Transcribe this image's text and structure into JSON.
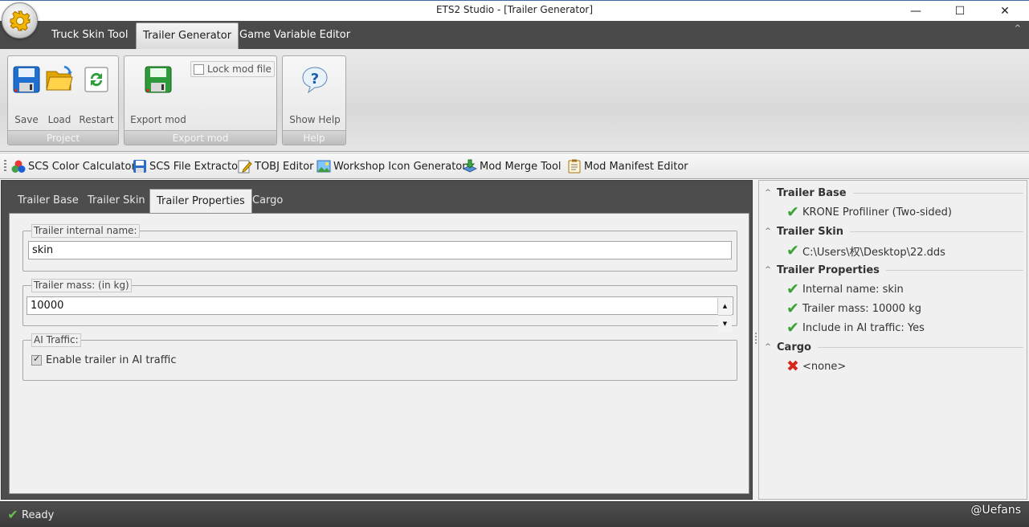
{
  "window": {
    "title": "ETS2 Studio - [Trailer Generator]",
    "minimize_glyph": "—",
    "maximize_glyph": "☐",
    "close_glyph": "✕"
  },
  "ribbon": {
    "tabs": [
      {
        "label": "Truck Skin Tool",
        "active": false
      },
      {
        "label": "Trailer Generator",
        "active": true
      },
      {
        "label": "Game Variable Editor",
        "active": false
      }
    ],
    "collapse_glyph": "^",
    "groups": {
      "project": {
        "caption": "Project",
        "save_label": "Save",
        "load_label": "Load",
        "restart_label": "Restart"
      },
      "export": {
        "caption": "Export mod",
        "export_label": "Export mod",
        "lock_label": "Lock mod file",
        "lock_checked": false
      },
      "help": {
        "caption": "Help",
        "show_help_label": "Show Help"
      }
    }
  },
  "toolbar": {
    "items": [
      {
        "label": "SCS Color Calculator",
        "icon": "color-balls-icon"
      },
      {
        "label": "SCS File Extractor",
        "icon": "floppy-blue-icon"
      },
      {
        "label": "TOBJ Editor",
        "icon": "pencil-note-icon"
      },
      {
        "label": "Workshop Icon Generator",
        "icon": "image-landscape-icon"
      },
      {
        "label": "Mod Merge Tool",
        "icon": "merge-layers-icon"
      },
      {
        "label": "Mod Manifest Editor",
        "icon": "clipboard-icon"
      }
    ]
  },
  "editor": {
    "tabs": [
      {
        "label": "Trailer Base",
        "active": false
      },
      {
        "label": "Trailer Skin",
        "active": false
      },
      {
        "label": "Trailer Properties",
        "active": true
      },
      {
        "label": "Cargo",
        "active": false
      }
    ],
    "internal_name": {
      "legend": "Trailer internal name:",
      "value": "skin"
    },
    "mass": {
      "legend": "Trailer mass: (in kg)",
      "value": "10000"
    },
    "ai_traffic": {
      "legend": "AI Traffic:",
      "checkbox_label": "Enable trailer in AI traffic",
      "checked": true
    }
  },
  "summary": {
    "sections": [
      {
        "title": "Trailer Base",
        "items": [
          {
            "text": "KRONE Profiliner (Two-sided)",
            "status": "ok"
          }
        ]
      },
      {
        "title": "Trailer Skin",
        "items": [
          {
            "text": "C:\\Users\\权\\Desktop\\22.dds",
            "status": "ok"
          }
        ]
      },
      {
        "title": "Trailer Properties",
        "items": [
          {
            "text": "Internal name: skin",
            "status": "ok"
          },
          {
            "text": "Trailer mass: 10000 kg",
            "status": "ok"
          },
          {
            "text": "Include in AI traffic: Yes",
            "status": "ok"
          }
        ]
      },
      {
        "title": "Cargo",
        "items": [
          {
            "text": "<none>",
            "status": "error"
          }
        ]
      }
    ],
    "ok_glyph": "✔",
    "error_glyph": "✖",
    "collapse_glyph": "^"
  },
  "status": {
    "text": "Ready",
    "icon_glyph": "✔",
    "watermark": "@Uefans"
  },
  "colors": {
    "ok": "#3aa335",
    "error": "#d7261a",
    "dark_chrome": "#4a4a4a"
  }
}
